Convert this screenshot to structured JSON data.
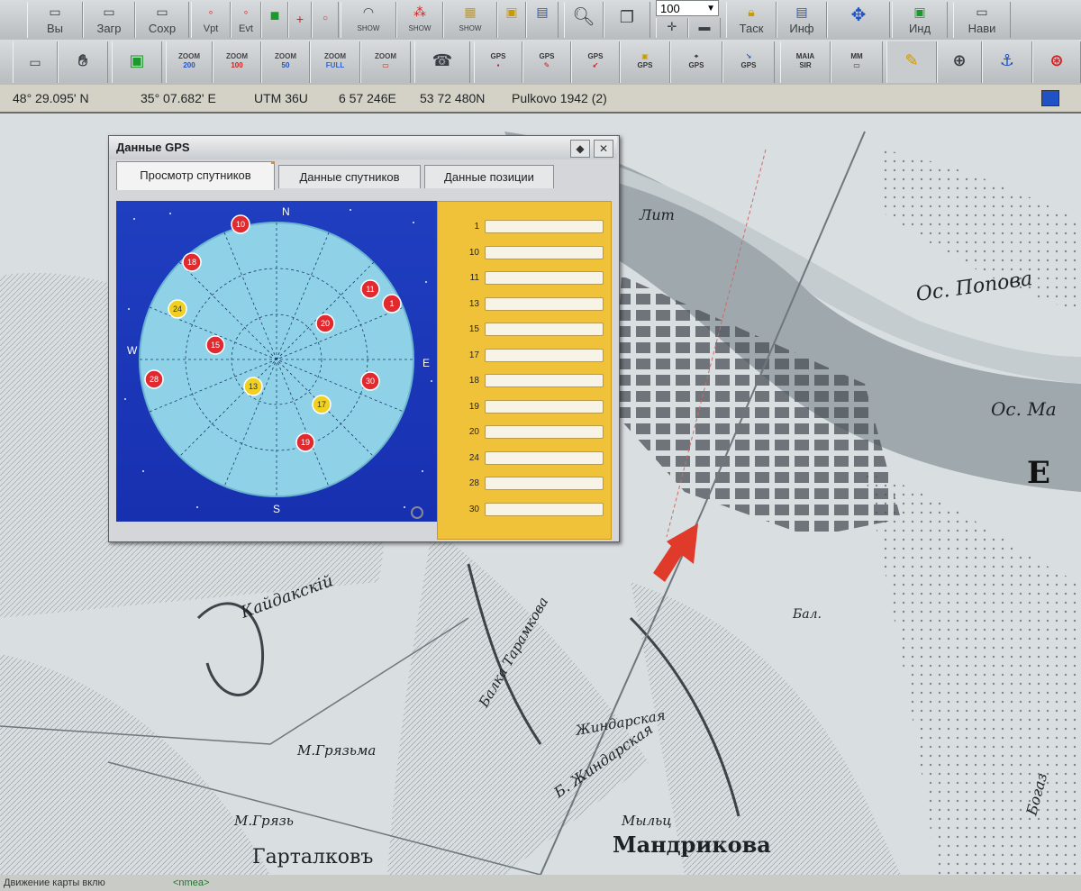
{
  "toolbar1": {
    "buttons": [
      {
        "name": "exit-button",
        "label": "Вы"
      },
      {
        "name": "load-button",
        "label": "Загр"
      },
      {
        "name": "save-button",
        "label": "Сохр"
      },
      {
        "name": "vpt-button",
        "label": "Vpt"
      },
      {
        "name": "evt-button",
        "label": "Evt"
      },
      {
        "name": "show-button-1",
        "label": "SHOW"
      },
      {
        "name": "show-button-2",
        "label": "SHOW"
      },
      {
        "name": "show-button-3",
        "label": "SHOW"
      },
      {
        "name": "task-button",
        "label": "Таск"
      },
      {
        "name": "info-button",
        "label": "Инф"
      },
      {
        "name": "ind-button",
        "label": "Инд"
      },
      {
        "name": "nav-button",
        "label": "Нави"
      }
    ],
    "zoom_value": "100"
  },
  "toolbar2": {
    "zoom_buttons": [
      {
        "top": "ZOOM",
        "bottom": "200"
      },
      {
        "top": "ZOOM",
        "bottom": "100"
      },
      {
        "top": "ZOOM",
        "bottom": "50"
      },
      {
        "top": "ZOOM",
        "bottom": "FULL"
      },
      {
        "top": "ZOOM",
        "bottom": ""
      }
    ],
    "gps_buttons": [
      {
        "top": "GPS",
        "bottom": ""
      },
      {
        "top": "GPS",
        "bottom": ""
      },
      {
        "top": "GPS",
        "bottom": ""
      },
      {
        "top": "",
        "bottom": "GPS"
      },
      {
        "top": "",
        "bottom": "GPS"
      },
      {
        "top": "",
        "bottom": "GPS"
      }
    ],
    "map_buttons": [
      {
        "top": "MAIA",
        "bottom": "SIR"
      },
      {
        "top": "MM",
        "bottom": ""
      }
    ]
  },
  "coords": {
    "lat": "48° 29.095' N",
    "lon": "35° 07.682' E",
    "utm_zone": "UTM  36U",
    "easting": "6 57 246E",
    "northing": "53 72 480N",
    "datum": "Pulkovo 1942 (2)"
  },
  "gps_dialog": {
    "title": "Данные GPS",
    "tabs": [
      "Просмотр спутников",
      "Данные спутников",
      "Данные позиции"
    ],
    "compass": {
      "n": "N",
      "s": "S",
      "e": "E",
      "w": "W"
    },
    "satellites": [
      {
        "id": "10",
        "color": "red"
      },
      {
        "id": "18",
        "color": "red"
      },
      {
        "id": "24",
        "color": "yellow"
      },
      {
        "id": "11",
        "color": "red"
      },
      {
        "id": "1",
        "color": "red"
      },
      {
        "id": "20",
        "color": "red"
      },
      {
        "id": "15",
        "color": "red"
      },
      {
        "id": "28",
        "color": "red"
      },
      {
        "id": "13",
        "color": "yellow"
      },
      {
        "id": "30",
        "color": "red"
      },
      {
        "id": "17",
        "color": "yellow"
      },
      {
        "id": "19",
        "color": "red"
      }
    ],
    "signal_list": [
      "1",
      "10",
      "11",
      "13",
      "15",
      "17",
      "18",
      "19",
      "20",
      "24",
      "28",
      "30"
    ]
  },
  "map_labels": {
    "river_label": "Лит",
    "island_label": "Ос. Попова",
    "island_label2": "Ос. Ма",
    "town_partial": "Е",
    "ravine1": "Кайдакскій",
    "ravine2": "Балка Тарамкова",
    "ravine3": "Б. Жиндарская",
    "ravine4": "Жиндарская",
    "place1": "М.Грязьма",
    "place2": "М.Грязь",
    "village": "Мандрикова",
    "village2": "Гарталковъ",
    "place3": "Мыльц",
    "stream1": "Бал.",
    "stream2": "Богаз"
  },
  "statusbar": {
    "text": "Движение карты вклю",
    "nmea": "<nmea>"
  }
}
